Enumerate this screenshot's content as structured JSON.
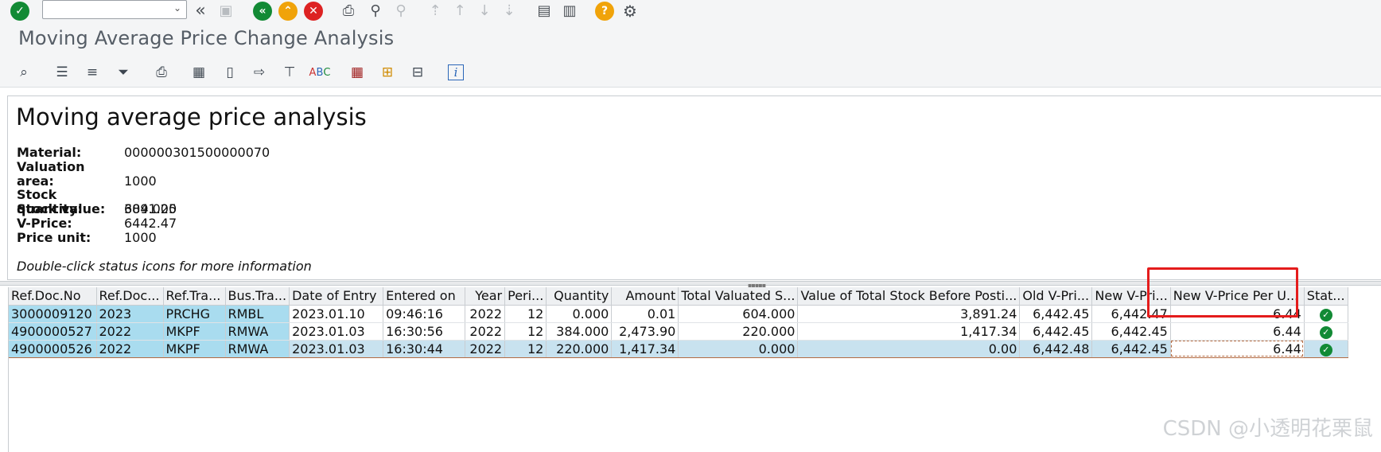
{
  "systoolbar": {
    "icons": {
      "enter": "check-circle-icon",
      "command_dropdown": "chevron-down-icon",
      "back_double": "double-left-arrow-icon",
      "save": "save-icon",
      "back": "back-icon",
      "exit": "exit-icon",
      "cancel": "cancel-icon",
      "print": "printer-icon",
      "find": "binoculars-icon",
      "find_next": "binoculars-plus-icon",
      "first_page": "first-page-icon",
      "prev_page": "prev-page-icon",
      "next_page": "next-page-icon",
      "last_page": "last-page-icon",
      "new_session": "new-session-icon",
      "shortcut": "shortcut-icon",
      "help": "help-icon",
      "settings": "gear-icon"
    },
    "command_value": ""
  },
  "title": "Moving Average Price Change Analysis",
  "apptoolbar": {
    "icons": [
      "details-icon",
      "sort-ascending-icon",
      "sort-descending-icon",
      "filter-icon",
      "print-preview-icon",
      "export-icon",
      "local-file-icon",
      "send-icon",
      "layout-icon",
      "spell-check-icon",
      "spreadsheet-icon",
      "change-layout-icon",
      "select-layout-icon",
      "info-icon"
    ]
  },
  "header": {
    "heading": "Moving average price analysis",
    "material_label": "Material:",
    "material_value": "000000301500000070",
    "valuation_area_label": "Valuation area:",
    "valuation_area_value": "1000",
    "stock_quantity_label": "Stock quantity:",
    "stock_quantity_value": "604.000",
    "stock_value_label": "Stock value:",
    "stock_value_value": "3891.25",
    "vprice_label": "V-Price:",
    "vprice_value": "6442.47",
    "price_unit_label": "Price unit:",
    "price_unit_value": "1000",
    "hint": "Double-click status icons for more information"
  },
  "grid": {
    "columns": [
      "Ref.Doc.No",
      "Ref.Doc...",
      "Ref.Tra...",
      "Bus.Tra...",
      "Date of Entry",
      "Entered on",
      "Year",
      "Peri...",
      "Quantity",
      "Amount",
      "Total Valuated S...",
      "Value of Total Stock Before Posti...",
      "Old V-Pri...",
      "New V-Pri...",
      "New V-Price Per U...",
      "Stat..."
    ],
    "rows": [
      [
        "3000009120",
        "2023",
        "PRCHG",
        "RMBL",
        "2023.01.10",
        "09:46:16",
        "2022",
        "12",
        "0.000",
        "0.01",
        "604.000",
        "3,891.24",
        "6,442.45",
        "6,442.47",
        "6.44",
        "ok"
      ],
      [
        "4900000527",
        "2022",
        "MKPF",
        "RMWA",
        "2023.01.03",
        "16:30:56",
        "2022",
        "12",
        "384.000",
        "2,473.90",
        "220.000",
        "1,417.34",
        "6,442.45",
        "6,442.45",
        "6.44",
        "ok"
      ],
      [
        "4900000526",
        "2022",
        "MKPF",
        "RMWA",
        "2023.01.03",
        "16:30:44",
        "2022",
        "12",
        "220.000",
        "1,417.34",
        "0.000",
        "0.00",
        "6,442.48",
        "6,442.45",
        "6.44",
        "ok"
      ]
    ],
    "status_icon": "check-circle-icon"
  },
  "watermark": "CSDN @小透明花栗鼠",
  "colors": {
    "highlight_box": "#e41c1c",
    "key_cell": "#a9dcef",
    "status_ok": "#128a35"
  }
}
